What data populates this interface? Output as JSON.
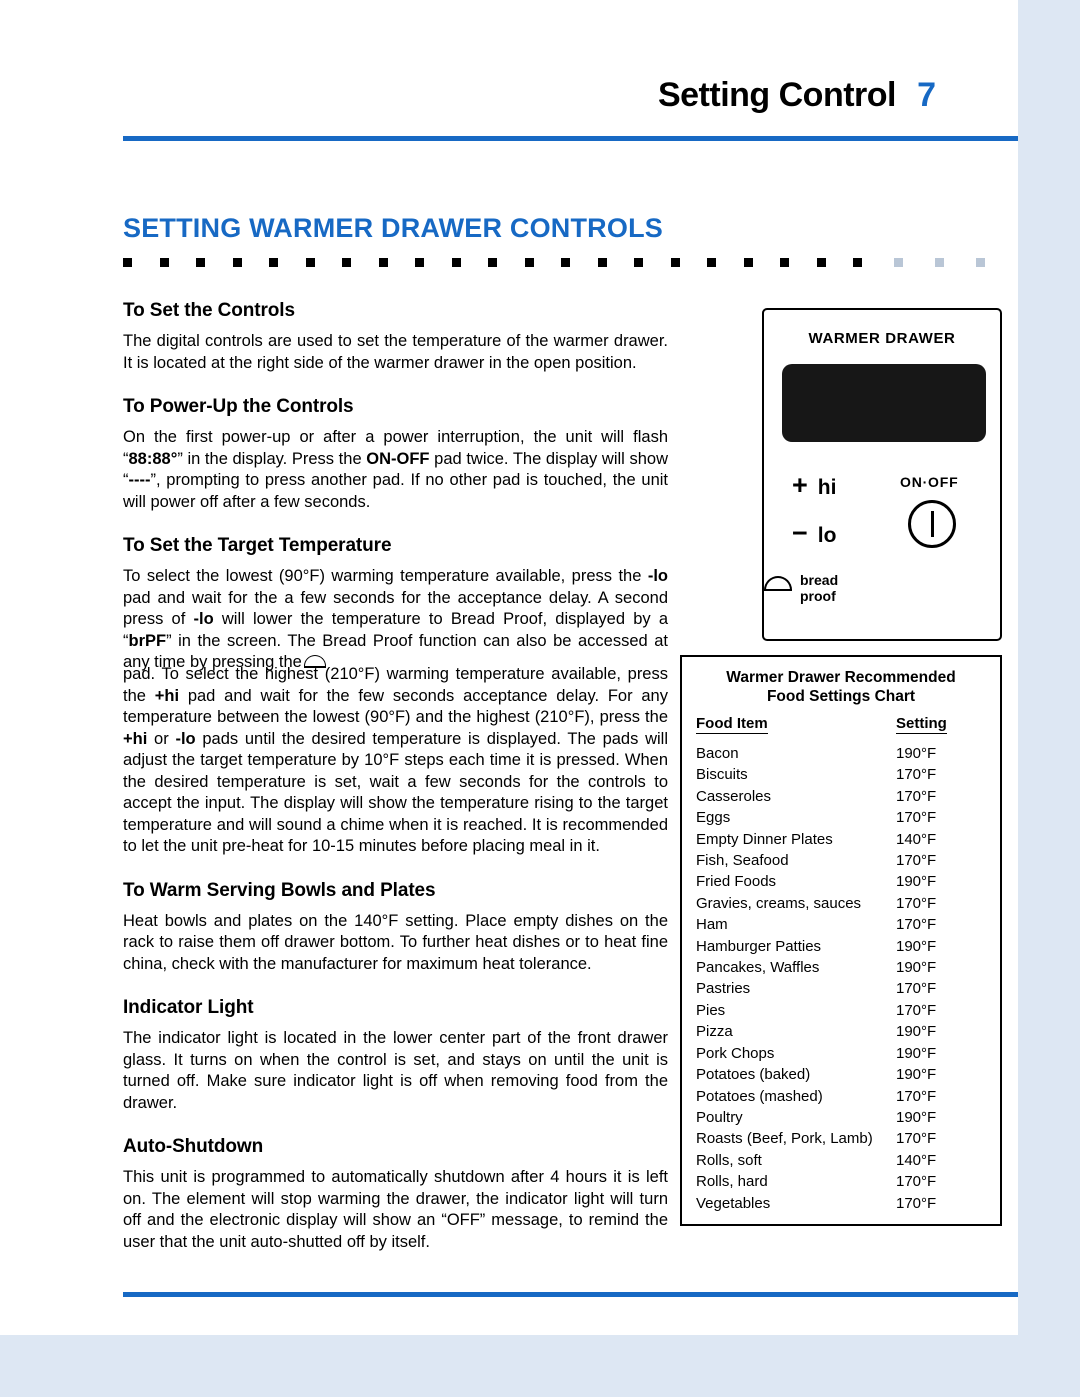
{
  "header": {
    "title": "Setting Control",
    "page_number": "7"
  },
  "section": {
    "title": "SETTING WARMER DRAWER CONTROLS"
  },
  "topics": [
    {
      "heading": "To Set the Controls",
      "body": "The digital controls are used to set the temperature of the warmer drawer. It is located at the right side of the warmer drawer in the open position."
    },
    {
      "heading": "To Power-Up the Controls"
    },
    {
      "heading": "To Set the Target Temperature"
    },
    {
      "heading": "To Warm Serving Bowls and Plates",
      "body": "Heat bowls and plates on the 140°F setting. Place empty dishes on the rack to raise them off drawer bottom. To further heat dishes or to heat fine china, check with the manufacturer for maximum heat tolerance."
    },
    {
      "heading": "Indicator Light",
      "body": "The indicator light is located in the lower center part of the front drawer glass. It turns on when the control is set, and stays on until the unit is turned off. Make sure indicator light is off when removing food from the drawer."
    },
    {
      "heading": "Auto-Shutdown",
      "body": "This unit is programmed to automatically shutdown after 4 hours it is left on. The element will stop warming the drawer, the indicator light will turn off and the electronic display will show an “OFF” message, to remind the user that the unit auto-shutted off by itself."
    }
  ],
  "powerup": {
    "p1_a": "On the first power-up or after  a power interruption, the unit will flash “",
    "p1_b": "88:88°",
    "p1_c": "” in the display. Press the ",
    "p1_d": "ON-OFF",
    "p1_e": " pad twice. The display will show “",
    "p1_f": "----",
    "p1_g": "”, prompting to press another pad. If no other pad is touched, the unit will power off after a few seconds."
  },
  "target_temp": {
    "p1_a": "To select the lowest (90°F) warming temperature available, press the ",
    "p1_b": "-lo",
    "p1_c": " pad and wait for the a few seconds for the acceptance delay. A second press of ",
    "p1_d": "-lo",
    "p1_e": " will lower the temperature to Bread Proof, displayed by a “",
    "p1_f": "brPF",
    "p1_g": "” in the screen. The Bread Proof function can also be accessed at any time by pressing the",
    "p2_a": "pad. To select the highest (210°F) warming temperature available, press the ",
    "p2_b": "+hi",
    "p2_c": " pad and wait for the few seconds acceptance delay. For any temperature between the lowest (90°F) and the highest (210°F), press the ",
    "p2_d": "+hi",
    "p2_e": " or ",
    "p2_f": "-lo",
    "p2_g": " pads until the desired temperature is displayed. The pads will adjust the target temperature by 10°F steps each time it is pressed. When the desired temperature is set, wait a few seconds for the controls to accept the input. The display will show the temperature rising to the target temperature and will sound a chime when it is reached. It is recommended to let the unit pre-heat for 10-15 minutes before placing meal in it."
  },
  "control_panel": {
    "label": "WARMER DRAWER",
    "hi_label": "hi",
    "hi_sign": "+",
    "lo_label": "lo",
    "lo_sign": "−",
    "onoff_label": "ON·OFF",
    "bread_line1": "bread",
    "bread_line2": "proof"
  },
  "food_chart": {
    "title_line1": "Warmer Drawer Recommended",
    "title_line2": "Food Settings Chart",
    "col_food": "Food Item",
    "col_setting": "Setting",
    "rows": [
      {
        "food": "Bacon",
        "setting": "190°F"
      },
      {
        "food": "Biscuits",
        "setting": "170°F"
      },
      {
        "food": "Casseroles",
        "setting": "170°F"
      },
      {
        "food": "Eggs",
        "setting": "170°F"
      },
      {
        "food": "Empty Dinner Plates",
        "setting": "140°F"
      },
      {
        "food": "Fish, Seafood",
        "setting": "170°F"
      },
      {
        "food": "Fried Foods",
        "setting": "190°F"
      },
      {
        "food": "Gravies, creams, sauces",
        "setting": "170°F"
      },
      {
        "food": "Ham",
        "setting": "170°F"
      },
      {
        "food": "Hamburger Patties",
        "setting": "190°F"
      },
      {
        "food": "Pancakes, Waffles",
        "setting": "190°F"
      },
      {
        "food": "Pastries",
        "setting": "170°F"
      },
      {
        "food": "Pies",
        "setting": "170°F"
      },
      {
        "food": "Pizza",
        "setting": "190°F"
      },
      {
        "food": "Pork Chops",
        "setting": "190°F"
      },
      {
        "food": "Potatoes (baked)",
        "setting": "190°F"
      },
      {
        "food": "Potatoes (mashed)",
        "setting": "170°F"
      },
      {
        "food": "Poultry",
        "setting": "190°F"
      },
      {
        "food": "Roasts (Beef, Pork, Lamb)",
        "setting": "170°F"
      },
      {
        "food": "Rolls, soft",
        "setting": "140°F"
      },
      {
        "food": "Rolls, hard",
        "setting": "170°F"
      },
      {
        "food": "Vegetables",
        "setting": "170°F"
      }
    ]
  },
  "colors": {
    "accent": "#1769c4",
    "band": "#dde7f3"
  }
}
